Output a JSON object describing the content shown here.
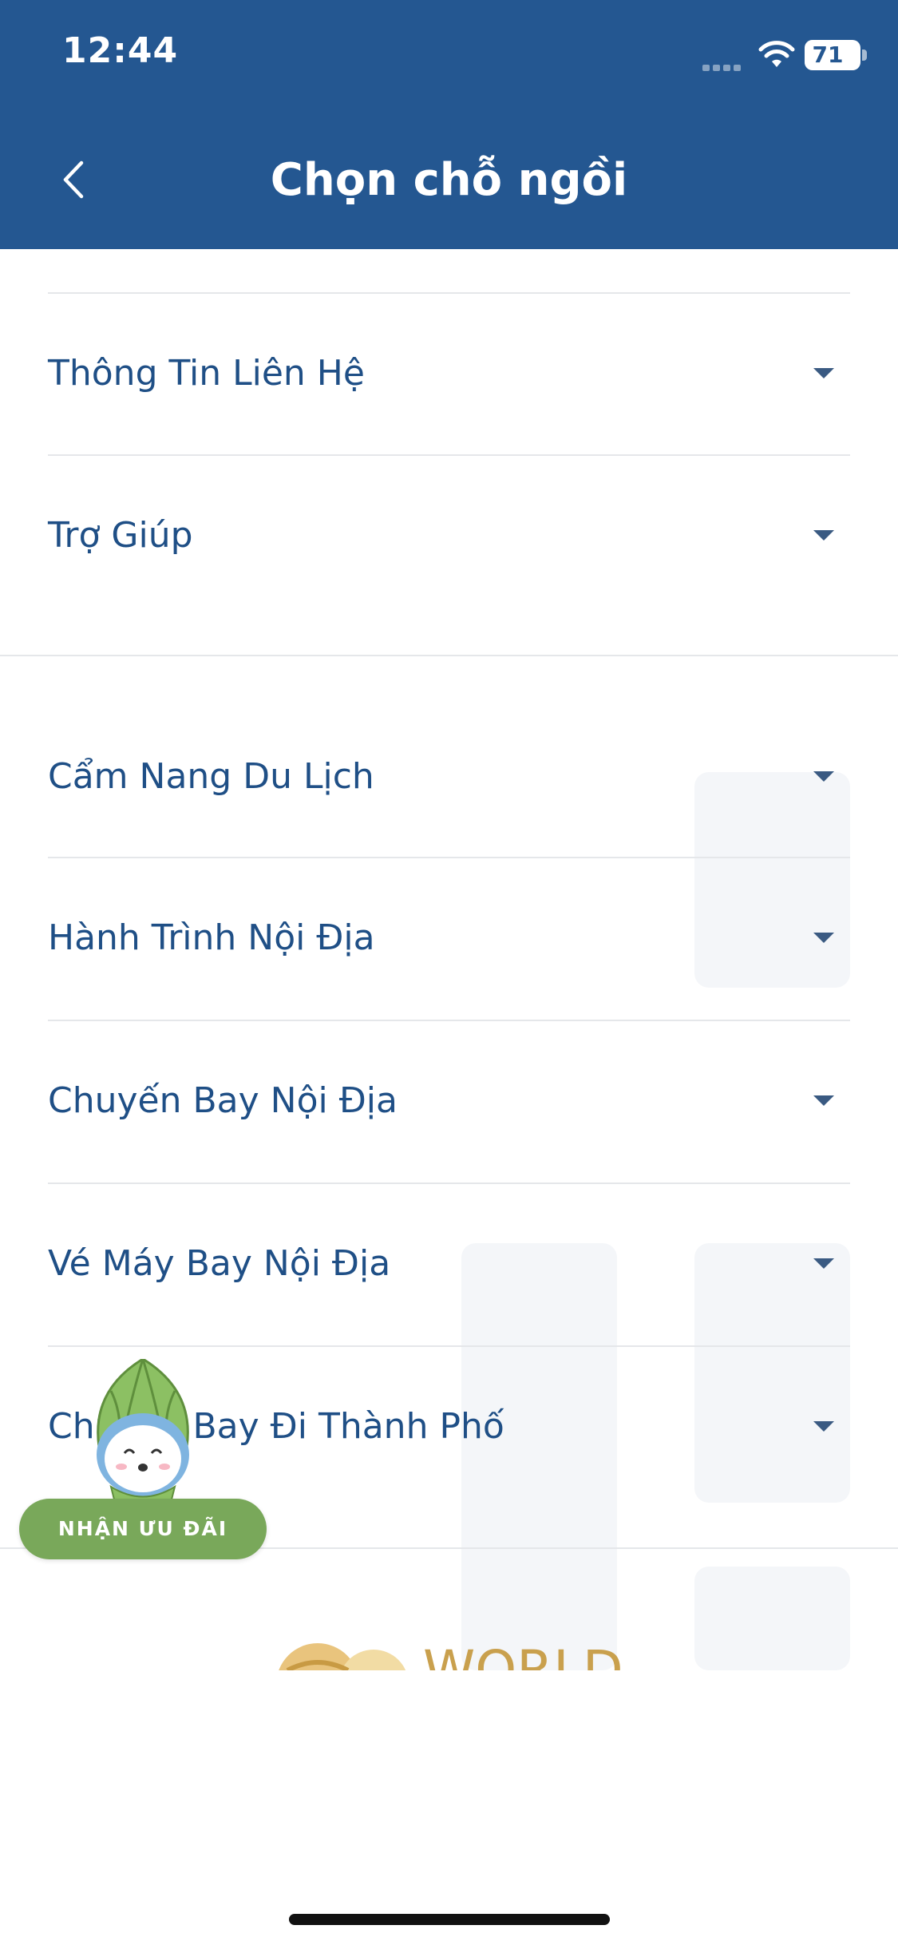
{
  "status_bar": {
    "time": "12:44",
    "battery": "71",
    "battery_level": 0.71
  },
  "header": {
    "title": "Chọn chỗ ngồi"
  },
  "menu": {
    "items": [
      {
        "label": "Thông Tin Liên Hệ"
      },
      {
        "label": "Trợ Giúp"
      },
      {
        "label": "Cẩm Nang Du Lịch"
      },
      {
        "label": "Hành Trình Nội Địa"
      },
      {
        "label": "Chuyến Bay Nội Địa"
      },
      {
        "label": "Vé Máy Bay Nội Địa"
      },
      {
        "label": "Chuyến Bay Đi Thành Phố"
      }
    ]
  },
  "promo": {
    "button_label": "NHẬN ƯU ĐÃI"
  },
  "footer_logo": {
    "text": "WORLD"
  },
  "colors": {
    "header_bg": "#245791",
    "text_primary": "#1f4f86",
    "promo_green": "#79a85a"
  }
}
